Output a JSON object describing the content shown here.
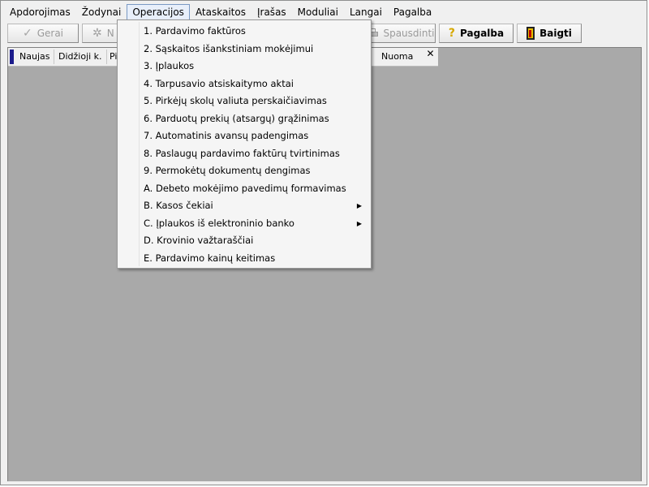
{
  "menubar": {
    "items": [
      {
        "label": "Apdorojimas"
      },
      {
        "label": "Žodynai"
      },
      {
        "label": "Operacijos"
      },
      {
        "label": "Ataskaitos"
      },
      {
        "label": "Įrašas"
      },
      {
        "label": "Moduliai"
      },
      {
        "label": "Langai"
      },
      {
        "label": "Pagalba"
      }
    ]
  },
  "toolbar": {
    "ok_label": "Gerai",
    "new_label": "N",
    "print_label": "Spausdinti",
    "help_label": "Pagalba",
    "exit_label": "Baigti"
  },
  "tabs": {
    "items": [
      {
        "label": "Naujas"
      },
      {
        "label": "Didžioji k."
      },
      {
        "label": "Pi"
      },
      {
        "label": "Nuoma"
      }
    ],
    "close_glyph": "✕"
  },
  "dropdown": {
    "items": [
      {
        "label": "1. Pardavimo faktūros"
      },
      {
        "label": "2. Sąskaitos išankstiniam mokėjimui"
      },
      {
        "label": "3. Įplaukos"
      },
      {
        "label": "4. Tarpusavio atsiskaitymo aktai"
      },
      {
        "label": "5. Pirkėjų skolų valiuta perskaičiavimas"
      },
      {
        "label": "6. Parduotų prekių (atsargų) grąžinimas"
      },
      {
        "label": "7. Automatinis avansų padengimas"
      },
      {
        "label": "8. Paslaugų pardavimo faktūrų tvirtinimas"
      },
      {
        "label": "9. Permokėtų dokumentų dengimas"
      },
      {
        "label": "A. Debeto mokėjimo pavedimų formavimas"
      },
      {
        "label": "B. Kasos čekiai"
      },
      {
        "label": "C. Įplaukos iš elektroninio banko"
      },
      {
        "label": "D. Krovinio važtaraščiai"
      },
      {
        "label": "E. Pardavimo kainų keitimas"
      }
    ]
  },
  "colors": {
    "mdi_background": "#a9a9a9",
    "menu_highlight_border": "#7a99c4",
    "tab_marker": "#1c1c8c"
  }
}
